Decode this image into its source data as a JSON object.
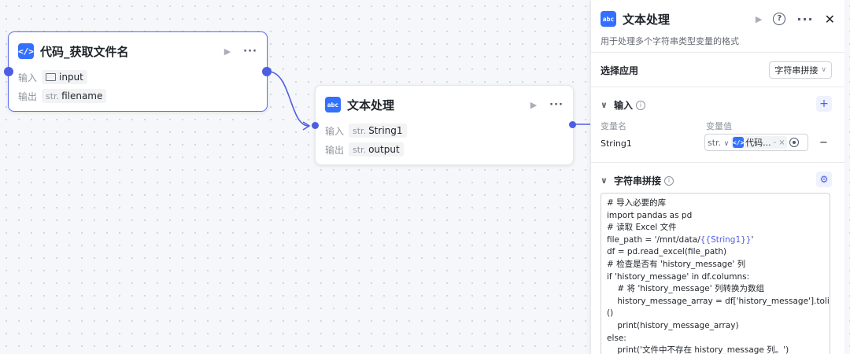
{
  "nodes": {
    "code": {
      "icon": "</>",
      "title": "代码_获取文件名",
      "input_label": "输入",
      "input_value": "input",
      "output_label": "输出",
      "output_type": "str.",
      "output_value": "filename"
    },
    "text": {
      "icon": "abc",
      "title": "文本处理",
      "input_label": "输入",
      "input_type": "str.",
      "input_value": "String1",
      "output_label": "输出",
      "output_type": "str.",
      "output_value": "output"
    }
  },
  "panel": {
    "icon": "abc",
    "title": "文本处理",
    "description": "用于处理多个字符串类型变量的格式",
    "select_app_label": "选择应用",
    "select_app_value": "字符串拼接",
    "input_section_title": "输入",
    "col_var_name": "变量名",
    "col_var_value": "变量值",
    "var_name": "String1",
    "var_type": "str.",
    "var_ref": "代码...",
    "var_ref_sep": "-",
    "concat_section_title": "字符串拼接",
    "code_lines": [
      "# 导入必要的库",
      "import pandas as pd",
      "# 读取 Excel 文件",
      "file_path = '/mnt/data/{{String1}}'",
      "df = pd.read_excel(file_path)",
      "# 检查是否有 'history_message' 列",
      "if 'history_message' in df.columns:",
      "    # 将 'history_message' 列转换为数组",
      "    history_message_array = df['history_message'].tolist",
      "()",
      "    print(history_message_array)",
      "else:",
      "    print('文件中不存在 history_message 列。')"
    ]
  },
  "icons": [
    "code-icon",
    "text-process-icon",
    "play-icon",
    "more-icon",
    "help-icon",
    "close-icon",
    "folder-icon",
    "info-icon",
    "plus-icon",
    "gear-icon",
    "target-icon",
    "chevron-down-icon"
  ],
  "colors": {
    "accent": "#4e5ee0",
    "node_icon": "#3370ff",
    "edge": "#4e5ee0"
  }
}
